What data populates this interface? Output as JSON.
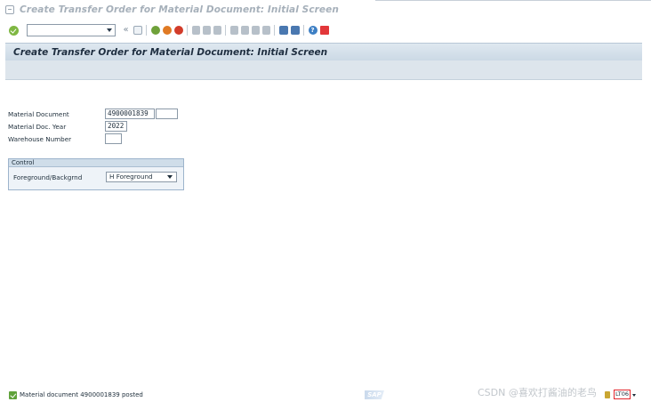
{
  "window": {
    "title": "Create Transfer Order for Material Document: Initial Screen"
  },
  "toolbar": {
    "command_field_value": "",
    "back_glyph": "«",
    "icons": [
      "ok-icon",
      "save-icon",
      "back-icon",
      "exit-icon",
      "cancel-icon",
      "print-icon",
      "find-icon",
      "find-next-icon",
      "first-page-icon",
      "previous-page-icon",
      "next-page-icon",
      "last-page-icon",
      "create-session-icon",
      "shortcut-icon",
      "help-icon",
      "customize-layout-icon"
    ]
  },
  "screen": {
    "title": "Create Transfer Order for Material Document: Initial Screen"
  },
  "form": {
    "material_document": {
      "label": "Material Document",
      "value": "4900001839",
      "item_value": ""
    },
    "material_doc_year": {
      "label": "Material Doc. Year",
      "value": "2022"
    },
    "warehouse_number": {
      "label": "Warehouse Number",
      "value": ""
    }
  },
  "control": {
    "group_title": "Control",
    "foreground_background": {
      "label": "Foreground/Backgrnd",
      "selected": "H Foreground"
    }
  },
  "status": {
    "message": "Material document 4900001839 posted",
    "sap_logo": "SAP",
    "tcode": "LT06",
    "watermark": "CSDN @喜欢打酱油的老鸟"
  },
  "colors": {
    "header_band": "#ccd9e5",
    "success": "#5fa23a",
    "highlight_box": "#e3262c"
  }
}
